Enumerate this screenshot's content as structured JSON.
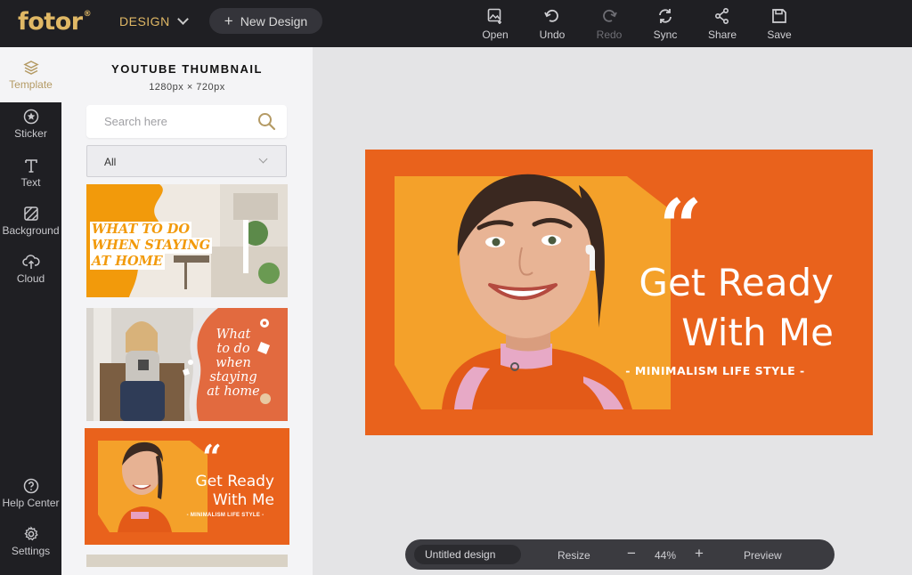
{
  "app": {
    "logo": "fotor",
    "logo_mark": "®"
  },
  "header": {
    "design_label": "DESIGN",
    "new_design_label": "New Design",
    "toolbar": [
      {
        "label": "Open",
        "icon": "open-image-icon",
        "enabled": true
      },
      {
        "label": "Undo",
        "icon": "undo-icon",
        "enabled": true
      },
      {
        "label": "Redo",
        "icon": "redo-icon",
        "enabled": false
      },
      {
        "label": "Sync",
        "icon": "sync-icon",
        "enabled": true
      },
      {
        "label": "Share",
        "icon": "share-icon",
        "enabled": true
      },
      {
        "label": "Save",
        "icon": "save-icon",
        "enabled": true
      }
    ]
  },
  "rail": {
    "items": [
      {
        "label": "Template",
        "icon": "layers-icon",
        "active": true
      },
      {
        "label": "Sticker",
        "icon": "star-icon",
        "active": false
      },
      {
        "label": "Text",
        "icon": "text-icon",
        "active": false
      },
      {
        "label": "Background",
        "icon": "background-icon",
        "active": false
      },
      {
        "label": "Cloud",
        "icon": "cloud-upload-icon",
        "active": false
      }
    ],
    "bottom_items": [
      {
        "label": "Help Center",
        "icon": "help-icon"
      },
      {
        "label": "Settings",
        "icon": "gear-icon"
      }
    ]
  },
  "panel": {
    "title": "YOUTUBE THUMBNAIL",
    "size": "1280px × 720px",
    "search_placeholder": "Search here",
    "filter_value": "All",
    "templates": [
      {
        "text": [
          "WHAT TO DO",
          "WHEN STAYING",
          "AT HOME"
        ],
        "accent": "#f29a0b"
      },
      {
        "text": [
          "What",
          "to do",
          "when",
          "staying",
          "at home"
        ],
        "accent": "#e26a3f"
      },
      {
        "quote": "“",
        "line1": "Get Ready",
        "line2": "With Me",
        "tagline": "- MINIMALISM LIFE STYLE -",
        "selected": true
      }
    ]
  },
  "canvas": {
    "quote": "“",
    "line1": "Get Ready",
    "line2": "With Me",
    "tagline": "- MINIMALISM LIFE STYLE -",
    "bg_color": "#e9621c",
    "panel_color": "#f4a12a"
  },
  "bottombar": {
    "design_name": "Untitled design",
    "resize_label": "Resize",
    "minus": "−",
    "zoom": "44%",
    "plus": "+",
    "preview_label": "Preview"
  },
  "colors": {
    "brand_gold": "#e0b865",
    "dark": "#1f1f23",
    "orange": "#e9621c"
  }
}
